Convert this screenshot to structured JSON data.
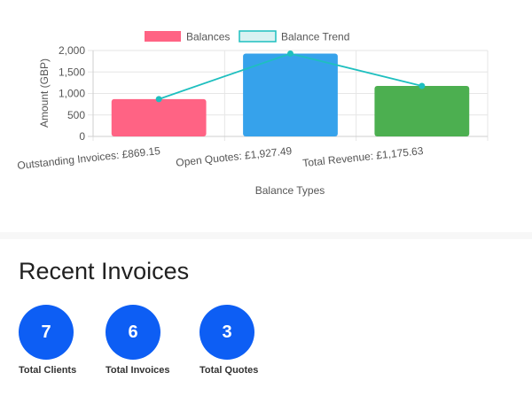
{
  "colors": {
    "balances_fill": [
      "#ff6384",
      "#36a2eb",
      "#4caf50"
    ],
    "trend_line": "#1ebfbf",
    "trend_legend_fill": "#d9f2f2",
    "stat_circle": "#0d5ef4"
  },
  "chart_data": {
    "type": "bar",
    "categories": [
      "Outstanding Invoices: £869.15",
      "Open Quotes: £1,927.49",
      "Total Revenue: £1,175.63"
    ],
    "series": [
      {
        "name": "Balances",
        "type": "bar",
        "values": [
          869.15,
          1927.49,
          1175.63
        ]
      },
      {
        "name": "Balance Trend",
        "type": "line",
        "values": [
          869.15,
          1927.49,
          1175.63
        ]
      }
    ],
    "xlabel": "Balance Types",
    "ylabel": "Amount (GBP)",
    "ylim": [
      0,
      2000
    ],
    "yticks": [
      "0",
      "500",
      "1,000",
      "1,500",
      "2,000"
    ],
    "grid": true,
    "legend_position": "top"
  },
  "recent": {
    "title": "Recent Invoices",
    "stats": [
      {
        "value": "7",
        "label": "Total Clients"
      },
      {
        "value": "6",
        "label": "Total Invoices"
      },
      {
        "value": "3",
        "label": "Total Quotes"
      }
    ]
  }
}
